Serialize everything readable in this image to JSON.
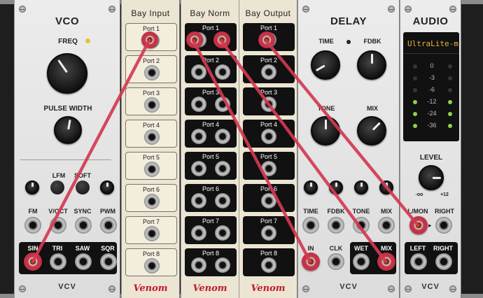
{
  "vco": {
    "title": "VCO",
    "freq_label": "FREQ",
    "pw_label": "PULSE WIDTH",
    "lfm_label": "LFM",
    "soft_label": "SOFT",
    "inputs": [
      "FM",
      "V/OCT",
      "SYNC",
      "PWM"
    ],
    "outputs": [
      "SIN",
      "TRI",
      "SAW",
      "SQR"
    ],
    "brand": "VCV"
  },
  "bay_input": {
    "title": "Bay Input",
    "ports": [
      "Port 1",
      "Port 2",
      "Port 3",
      "Port 4",
      "Port 5",
      "Port 6",
      "Port 7",
      "Port 8"
    ],
    "brand": "Venom"
  },
  "bay_norm": {
    "title": "Bay Norm",
    "ports": [
      "Port 1",
      "Port 2",
      "Port 3",
      "Port 4",
      "Port 5",
      "Port 6",
      "Port 7",
      "Port 8"
    ],
    "brand": "Venom"
  },
  "bay_output": {
    "title": "Bay Output",
    "ports": [
      "Port 1",
      "Port 2",
      "Port 3",
      "Port 4",
      "Port 5",
      "Port 6",
      "Port 7",
      "Port 8"
    ],
    "brand": "Venom"
  },
  "delay": {
    "title": "DELAY",
    "knobs": [
      "TIME",
      "FDBK",
      "TONE",
      "MIX"
    ],
    "cv_labels": [
      "TIME",
      "FDBK",
      "TONE",
      "MIX"
    ],
    "in_label": "IN",
    "clk_label": "CLK",
    "wet_label": "WET",
    "mix_out_label": "MIX",
    "brand": "VCV"
  },
  "audio": {
    "title": "AUDIO",
    "device": "UltraLite-mk",
    "meter_labels": [
      "0",
      "-3",
      "-6",
      "-12",
      "-24",
      "-36"
    ],
    "level_label": "LEVEL",
    "level_min": "-oo",
    "level_max": "+12",
    "in_labels": [
      "L/MON",
      "RIGHT"
    ],
    "out_labels": [
      "LEFT",
      "RIGHT"
    ],
    "brand": "VCV"
  },
  "colors": {
    "cable": "#d23a52",
    "venom": "#c0182c",
    "meter_green": "#8fd14f"
  }
}
